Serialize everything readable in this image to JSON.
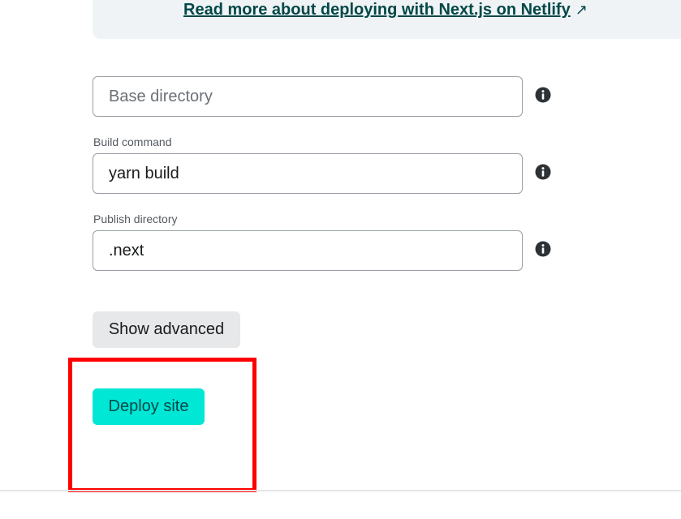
{
  "info_box": {
    "link_text": "Read more about deploying with Next.js on Netlify",
    "link_icon": "external-arrow-icon"
  },
  "fields": {
    "base_directory": {
      "placeholder": "Base directory",
      "value": ""
    },
    "build_command": {
      "label": "Build command",
      "value": "yarn build"
    },
    "publish_directory": {
      "label": "Publish directory",
      "value": ".next"
    },
    "help_icon": "info-circle-icon"
  },
  "buttons": {
    "show_advanced": "Show advanced",
    "deploy_site": "Deploy site"
  },
  "colors": {
    "accent_teal": "#00e7d6",
    "link_dark_teal": "#014847",
    "highlight_red": "#ff0000",
    "info_box_bg": "#f0f3f6"
  }
}
